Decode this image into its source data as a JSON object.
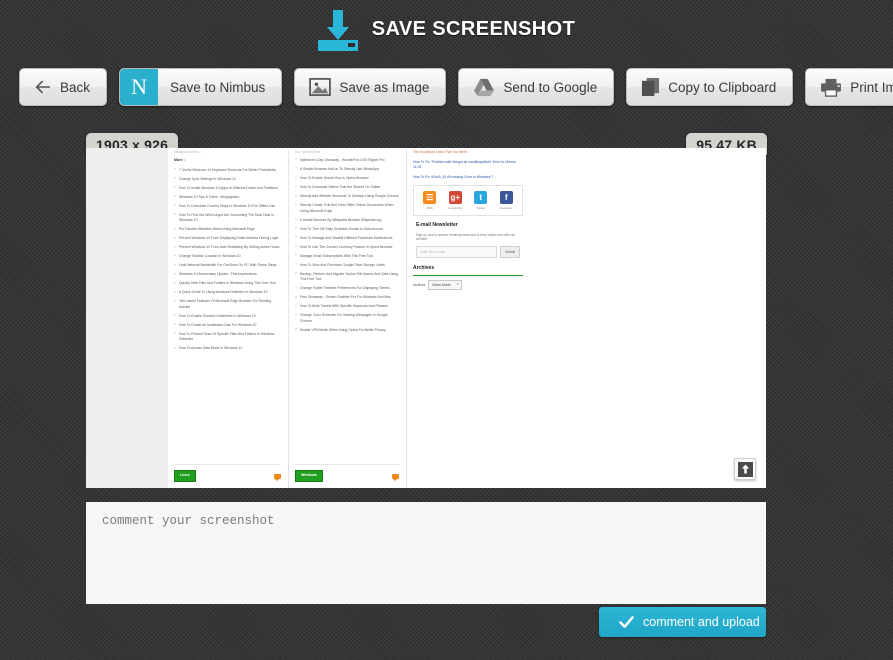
{
  "header": {
    "title": "SAVE SCREENSHOT",
    "logo_icon": "download-to-tray-icon",
    "accent_color": "#29b6d8"
  },
  "toolbar": {
    "buttons": [
      {
        "label": "Back",
        "icon": "arrow-left-icon"
      },
      {
        "label": "Save to Nimbus",
        "icon": "nimbus-n-logo-icon"
      },
      {
        "label": "Save as Image",
        "icon": "image-icon"
      },
      {
        "label": "Send to Google",
        "icon": "google-drive-icon"
      },
      {
        "label": "Copy to Clipboard",
        "icon": "copy-stack-icon"
      },
      {
        "label": "Print Image",
        "icon": "printer-icon"
      }
    ]
  },
  "badges": {
    "dimensions": "1903 x 926",
    "filesize": "95.47 KB"
  },
  "preview": {
    "scroll_top_icon": "arrow-up-icon",
    "column1": {
      "faded_text": "background even...",
      "heading": "More :",
      "items": [
        "7 Useful Windows 10 Keyboard Shortcuts For Better Productivity",
        "Change Sync Settings In Windows 10",
        "How To Install Windows 10 Apps In Different Drives And Partitions",
        "Windows 10 Tips & Tricks : Infographics",
        "How To Download Country Maps In Windows 10 For Offline Use",
        "How To Find Out Which Apps Are Consuming The Most Data In Windows 10",
        "Pin Favorite Websites When Using Microsoft Edge",
        "Prevent Windows 10 From Displaying Email Address During Login",
        "Prevent Windows 10 From Auto Restarting By Setting Active Hours",
        "Change Taskbar Location In Windows 10",
        "Limit Network Bandwidth For OneDrive On PC With These Steps",
        "Windows 10 Anniversary Update : First Impressions",
        "Quickly Hide Files And Folders In Windows Using This Free Tool",
        "A Quick Guide To Using Windows Defender In Windows 10",
        "Two Useful Features Of Microsoft Edge Browser For Reading Articles",
        "How To Enable Shortcut Underlines In Windows 10",
        "How To Create An Installation Disk For Windows 10",
        "How To Prevent Scan Of Specific Files And Folders In Windows Defender",
        "How To Access Safe Mode In Windows 10"
      ],
      "category": "Linux"
    },
    "column2": {
      "faded_text": "Any Torrent Client",
      "items": [
        "Valentine's Day Giveaway : WonderFox DVD Ripper Pro",
        "A Simple Browser Add-on To Directly Use WhatsApp",
        "How To Enable Search Box In Opera Browser",
        "How To Download Videos That Are Shared On Twitter",
        "Directly Add Website Shortcuts To Desktop Using Google Chrome",
        "Directly Create, Edit And View Office Online Documents When Using Microsoft Edge",
        "5 Useful Services By Wikipedia Besides Wikipedia.org",
        "How To Turn Off Daily Schedule Emails In Outlook.com",
        "How To Manage And Disable Different Facebook Notifications",
        "How To Use The Convert Currency Feature In Opera Browser",
        "Manage Email Subscriptions With This Free Tool",
        "How To View And Purchase Google Drive Storage Limits",
        "Backup, Restore And Migrate Oculus Rift Games And Data Using This Free Tool",
        "Change Twitter Timeline Preferences For Displaying Tweets",
        "Free Giveaway : Screen Grabber Pro For Windows And Mac",
        "How To Mute Tweets With Specific Keywords And Phrases",
        "Change Color Schemes For Viewing Webpages In Google Chrome",
        "Enable VPN Mode When Using Opera For Better Privacy"
      ],
      "category": "Windows"
    },
    "sidebar": {
      "links": [
        "The Download Links That You Need",
        "How To Fix \"Problem with MergeList /var/lib/apt/lists\" Error In Ubuntu 11.04",
        "How To Fix 'd3dx9_43.dll missing' Error In Windows 7"
      ],
      "social": [
        {
          "name": "RSS",
          "glyph": "☲",
          "icon": "rss-icon"
        },
        {
          "name": "GooglePlus",
          "glyph": "g+",
          "icon": "google-plus-icon"
        },
        {
          "name": "Twitter",
          "glyph": "t",
          "icon": "twitter-icon"
        },
        {
          "name": "Facebook",
          "glyph": "f",
          "icon": "facebook-icon"
        }
      ],
      "newsletter_title": "E-mail Newsletter",
      "newsletter_sub": "Sign up now to receive breaking news and to hear what's new with our website!",
      "newsletter_placeholder": "Enter Your E-mail",
      "newsletter_submit": "Submit",
      "archives_title": "Archives",
      "archives_label": "Archives",
      "archives_select": "Select Month"
    }
  },
  "comment": {
    "placeholder": "comment your screenshot",
    "value": ""
  },
  "upload": {
    "label": "comment and upload",
    "icon": "check-icon",
    "color": "#2db6d6"
  }
}
